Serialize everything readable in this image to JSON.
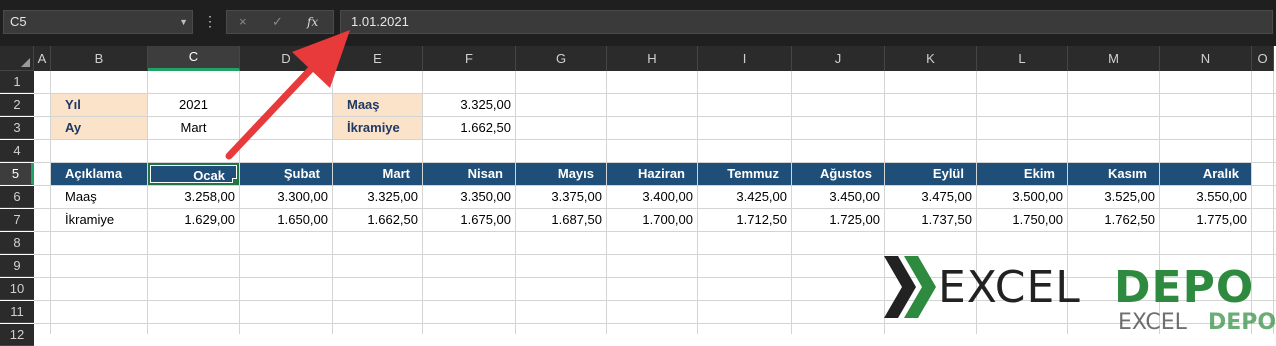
{
  "name_box": "C5",
  "formula_bar": "1.01.2021",
  "icons": {
    "cancel": "×",
    "enter": "✓",
    "fx": "fx",
    "more": "⋮",
    "dropdown": "▼"
  },
  "columns": [
    "A",
    "B",
    "C",
    "D",
    "E",
    "F",
    "G",
    "H",
    "I",
    "J",
    "K",
    "L",
    "M",
    "N",
    "O"
  ],
  "rows": [
    "1",
    "2",
    "3",
    "4",
    "5",
    "6",
    "7",
    "8",
    "9",
    "10",
    "11",
    "12"
  ],
  "params": {
    "yil_label": "Yıl",
    "yil_value": "2021",
    "ay_label": "Ay",
    "ay_value": "Mart",
    "maas_label": "Maaş",
    "maas_value": "3.325,00",
    "ikramiye_label": "İkramiye",
    "ikramiye_value": "1.662,50"
  },
  "table": {
    "header_label": "Açıklama",
    "months": [
      "Ocak",
      "Şubat",
      "Mart",
      "Nisan",
      "Mayıs",
      "Haziran",
      "Temmuz",
      "Ağustos",
      "Eylül",
      "Ekim",
      "Kasım",
      "Aralık"
    ],
    "row_labels": [
      "Maaş",
      "İkramiye"
    ],
    "maas": [
      "3.258,00",
      "3.300,00",
      "3.325,00",
      "3.350,00",
      "3.375,00",
      "3.400,00",
      "3.425,00",
      "3.450,00",
      "3.475,00",
      "3.500,00",
      "3.525,00",
      "3.550,00"
    ],
    "ikramiye": [
      "1.629,00",
      "1.650,00",
      "1.662,50",
      "1.675,00",
      "1.687,50",
      "1.700,00",
      "1.712,50",
      "1.725,00",
      "1.737,50",
      "1.750,00",
      "1.762,50",
      "1.775,00"
    ]
  },
  "logo": {
    "excel": "EXCEL",
    "depo": "DEPO"
  },
  "colors": {
    "header_fill": "#1f4e79",
    "label_fill": "#fbe3c9",
    "arrow": "#e8393b",
    "logo_green": "#2d8a3e",
    "selection": "#217346"
  }
}
